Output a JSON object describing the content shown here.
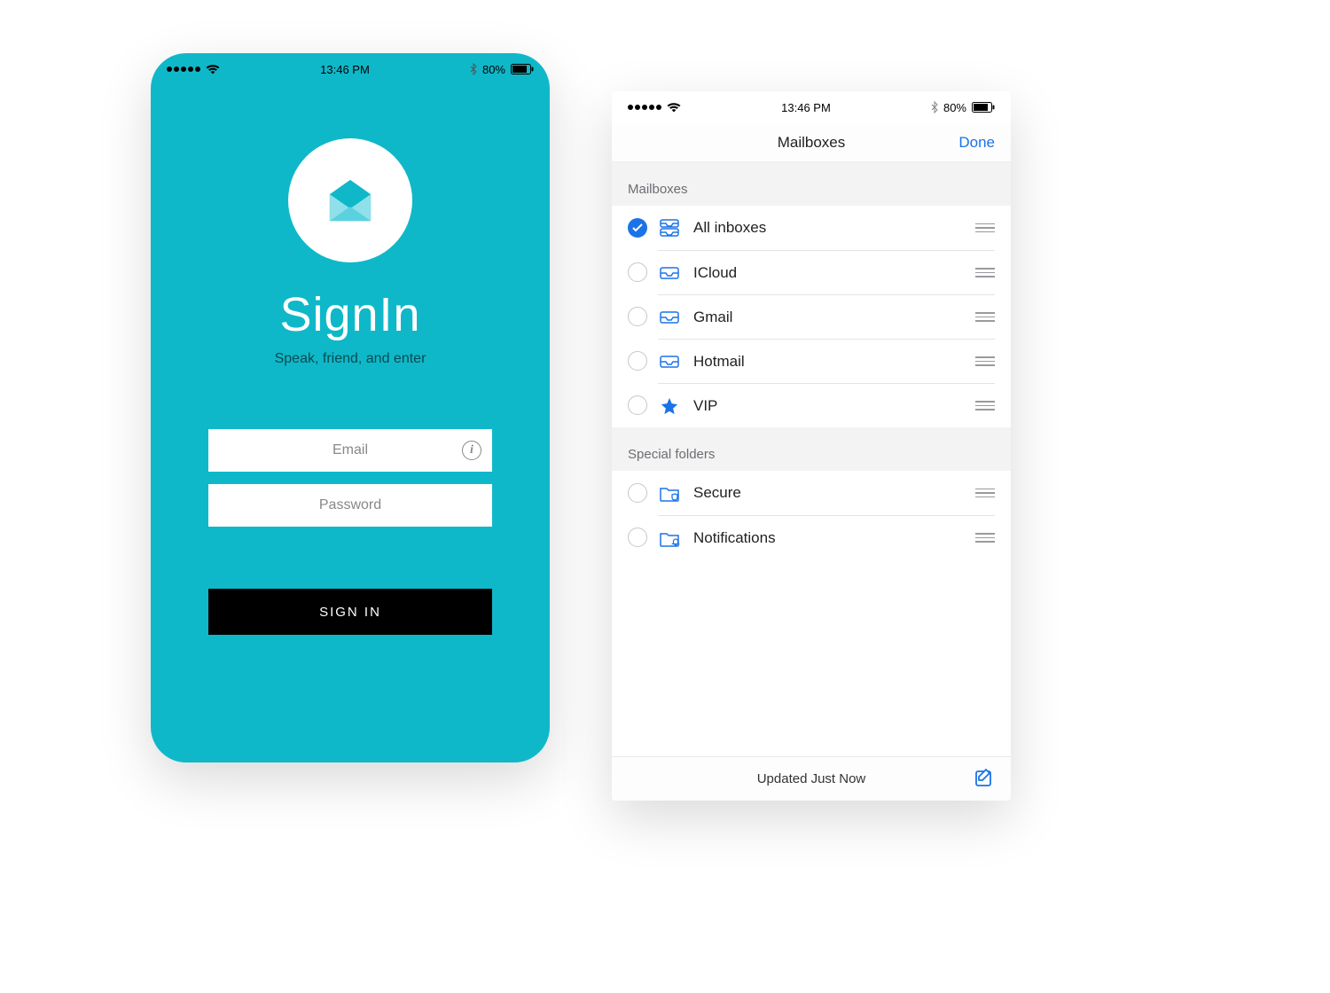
{
  "status": {
    "time": "13:46 PM",
    "battery_text": "80%"
  },
  "signin": {
    "title": "SignIn",
    "tagline": "Speak, friend, and enter",
    "email_placeholder": "Email",
    "password_placeholder": "Password",
    "button_label": "SIGN IN"
  },
  "mailboxes": {
    "nav_title": "Mailboxes",
    "done_label": "Done",
    "section1_header": "Mailboxes",
    "section2_header": "Special folders",
    "items": [
      {
        "label": "All inboxes",
        "checked": true,
        "icon": "tray-stack"
      },
      {
        "label": "ICloud",
        "checked": false,
        "icon": "tray"
      },
      {
        "label": "Gmail",
        "checked": false,
        "icon": "tray"
      },
      {
        "label": "Hotmail",
        "checked": false,
        "icon": "tray"
      },
      {
        "label": "VIP",
        "checked": false,
        "icon": "star"
      }
    ],
    "special": [
      {
        "label": "Secure",
        "checked": false,
        "icon": "folder-shield"
      },
      {
        "label": "Notifications",
        "checked": false,
        "icon": "folder-bell"
      }
    ],
    "footer_text": "Updated Just Now"
  },
  "colors": {
    "teal": "#0fb8c9",
    "ios_blue": "#1b73e8"
  }
}
